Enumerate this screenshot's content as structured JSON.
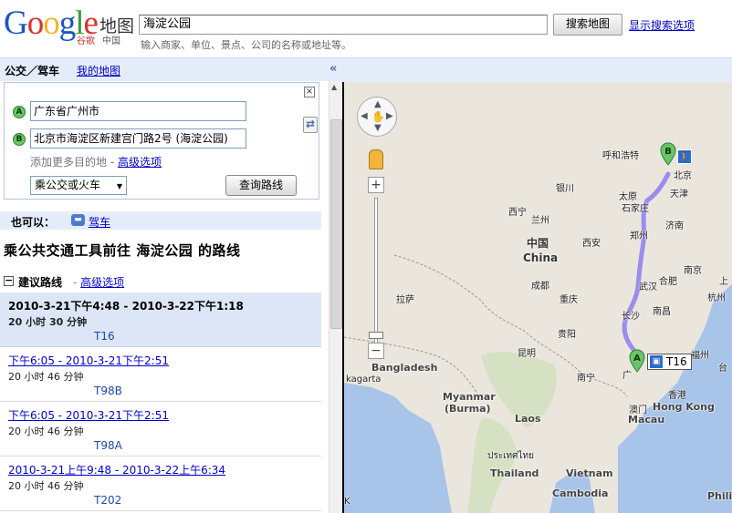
{
  "header": {
    "logo_word": "Google",
    "logo_maps": "地图",
    "logo_sub": "谷歌",
    "logo_china": "中国",
    "search_value": "海淀公园",
    "search_button": "搜索地图",
    "show_options": "显示搜索选项",
    "search_hint": "输入商家、单位、景点、公司的名称或地址等。"
  },
  "tabs": {
    "active": "公交／驾车",
    "my_maps": "我的地图",
    "collapse": "«"
  },
  "directions": {
    "close": "×",
    "marker_a": "A",
    "marker_b": "B",
    "from": "广东省广州市",
    "to": "北京市海淀区新建宫门路2号 (海淀公园)",
    "swap": "⇄",
    "add_destination": "添加更多目的地",
    "separator": "-",
    "advanced_options": "高级选项",
    "mode": "乘公交或火车",
    "query_button": "查询路线"
  },
  "alternative": {
    "label": "也可以：",
    "drive": "驾车"
  },
  "route_title": "乘公共交通工具前往 海淀公园 的路线",
  "suggested": {
    "toggle": "−",
    "label": "建议路线",
    "dash": "-",
    "advanced": "高级选项"
  },
  "routes": [
    {
      "time": "2010-3-21下午4:48 - 2010-3-22下午1:18",
      "duration": "20 小时 30 分钟",
      "train": "T16"
    },
    {
      "time": "下午6:05 - 2010-3-21下午2:51",
      "duration": "20 小时 46 分钟",
      "train": "T98B"
    },
    {
      "time": "下午6:05 - 2010-3-21下午2:51",
      "duration": "20 小时 46 分钟",
      "train": "T98A"
    },
    {
      "time": "2010-3-21上午9:48 - 2010-3-22上午6:34",
      "duration": "20 小时 46 分钟",
      "train": "T202"
    }
  ],
  "map": {
    "labels": {
      "hohhot": "呼和浩特",
      "beijing": "北京",
      "tianjin": "天津",
      "yinchuan": "银川",
      "taiyuan": "太原",
      "shijiazhuang": "石家庄",
      "jinan": "济南",
      "xining": "西宁",
      "lanzhou": "兰州",
      "zhengzhou": "郑州",
      "china_cn": "中国",
      "china_en": "China",
      "xian": "西安",
      "nanjing": "南京",
      "hefei": "合肥",
      "wuhan": "武汉",
      "hangzhou": "杭州",
      "shanghai": "上",
      "chengdu": "成都",
      "chongqing": "重庆",
      "lhasa": "拉萨",
      "changsha": "长沙",
      "nanchang": "南昌",
      "guiyang": "贵阳",
      "fuzhou": "福州",
      "taipei": "台",
      "kunming": "昆明",
      "nanning": "南宁",
      "guangzhou": "广",
      "hongkong_cn": "香港",
      "hongkong_en": "Hong Kong",
      "macau_cn": "澳门",
      "macau_en": "Macau",
      "bangladesh": "Bangladesh",
      "kolkata": "Kolkata",
      "kagarta": "kagarta",
      "myanmar": "Myanmar",
      "burma": "(Burma)",
      "laos": "Laos",
      "thailand_th": "ประเทศไทย",
      "thailand": "Thailand",
      "vietnam": "Vietnam",
      "cambodia": "Cambodia",
      "phili": "Phili",
      "ke": "K"
    },
    "pin_a": "A",
    "pin_b": "B",
    "train_label": "T16",
    "route_color": "#8c7cf0",
    "water_color": "#a8c4e8",
    "land_color": "#eae6dd"
  }
}
